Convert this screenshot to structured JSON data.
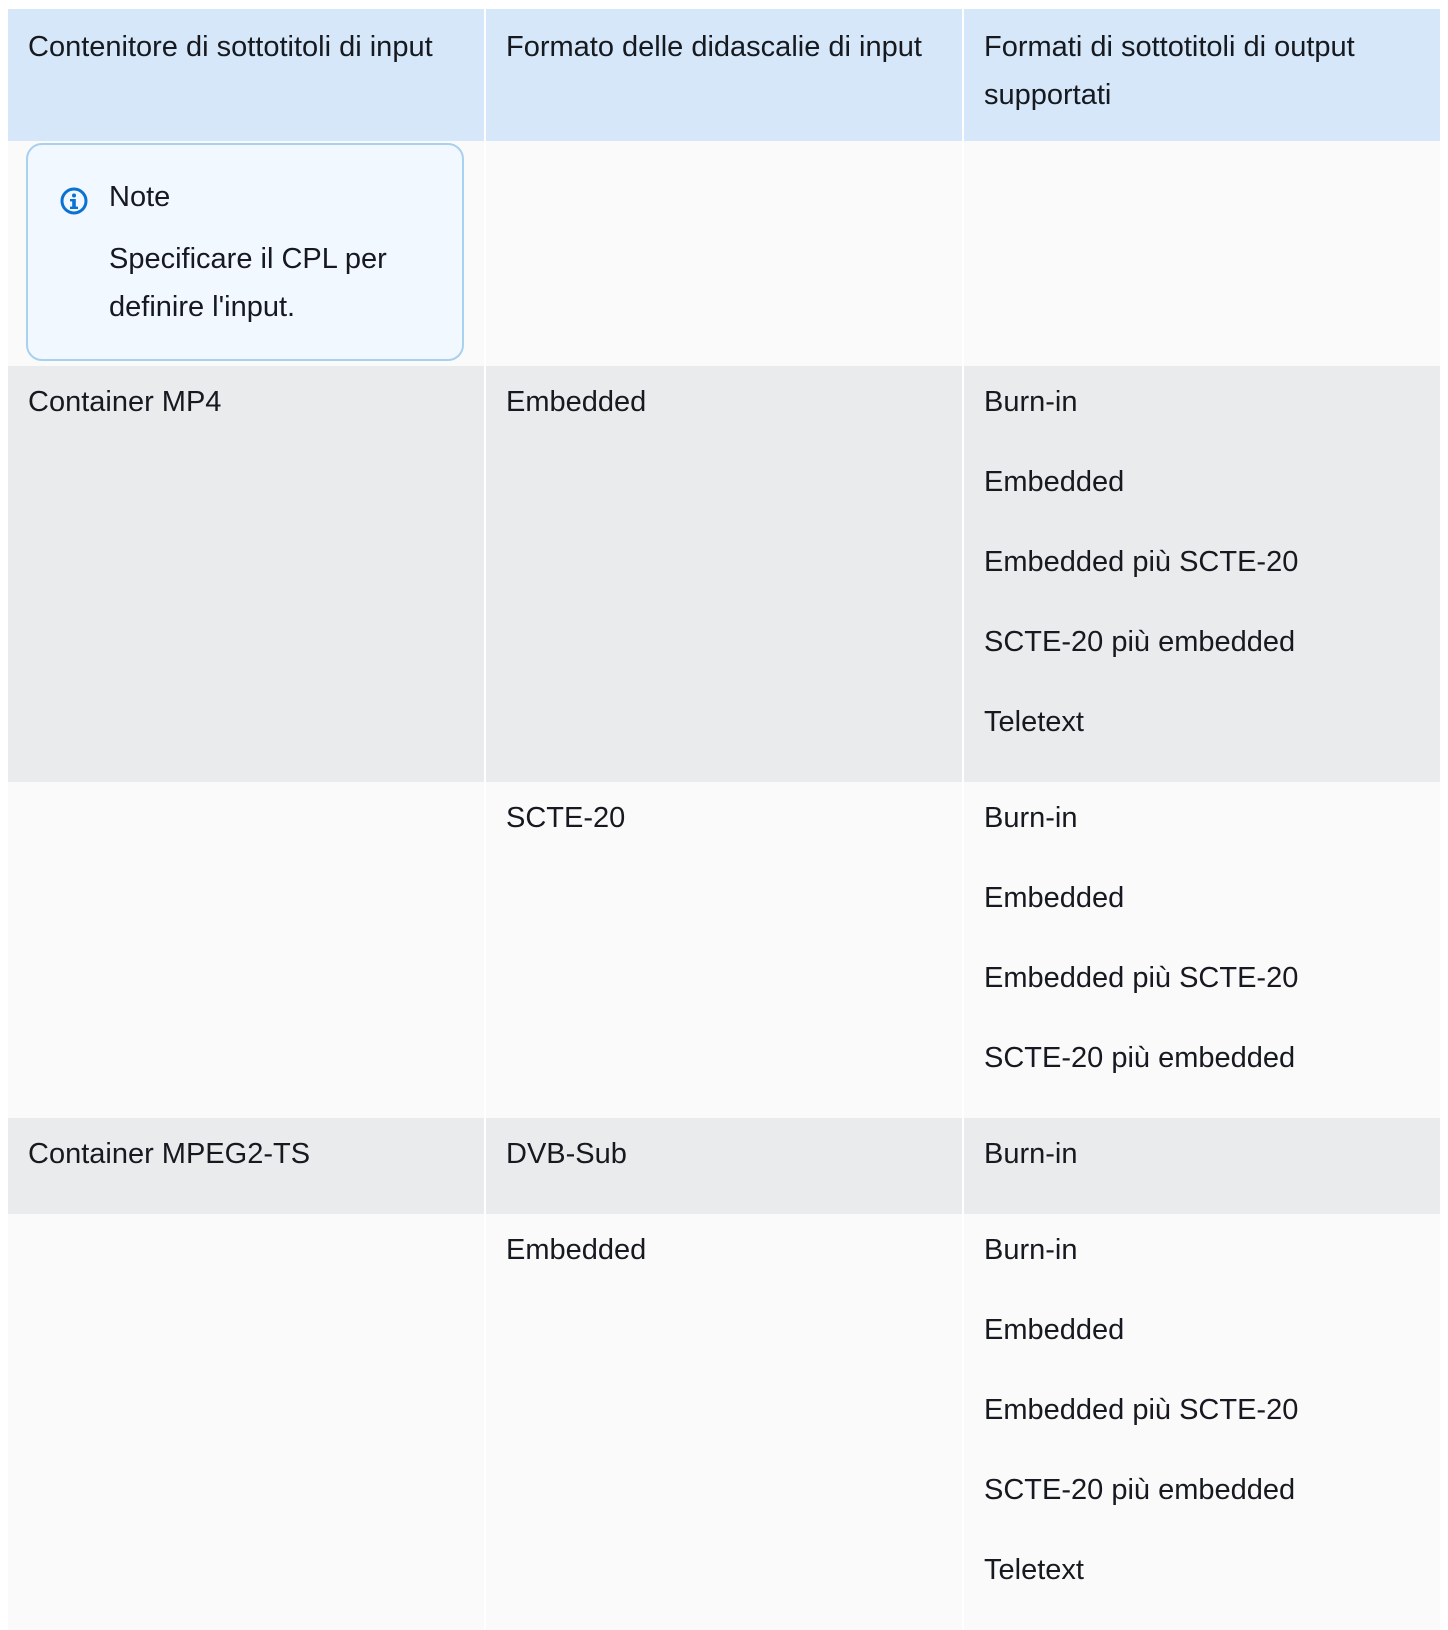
{
  "table": {
    "headers": [
      "Contenitore di sottotitoli di input",
      "Formato delle didascalie di input",
      "Formati di sottotitoli di output supportati"
    ],
    "note": {
      "title": "Note",
      "body": "Specificare il CPL per definire l'input."
    },
    "rows": [
      {
        "container": "Container MP4",
        "format": "Embedded",
        "outputs": [
          "Burn-in",
          "Embedded",
          "Embedded più SCTE-20",
          "SCTE-20 più embedded",
          "Teletext"
        ]
      },
      {
        "container": "",
        "format": "SCTE-20",
        "outputs": [
          "Burn-in",
          "Embedded",
          "Embedded più SCTE-20",
          "SCTE-20 più embedded"
        ]
      },
      {
        "container": "Container MPEG2-TS",
        "format": "DVB-Sub",
        "outputs": [
          "Burn-in"
        ]
      },
      {
        "container": "",
        "format": "Embedded",
        "outputs": [
          "Burn-in",
          "Embedded",
          "Embedded più SCTE-20",
          "SCTE-20 più embedded",
          "Teletext"
        ]
      }
    ]
  },
  "colors": {
    "header_bg": "#d5e7f8",
    "row_light": "#fafafa",
    "row_dark": "#eaebec",
    "note_border": "#a8d0ef",
    "note_bg": "#f1f8ff",
    "info_icon": "#0972d3"
  }
}
